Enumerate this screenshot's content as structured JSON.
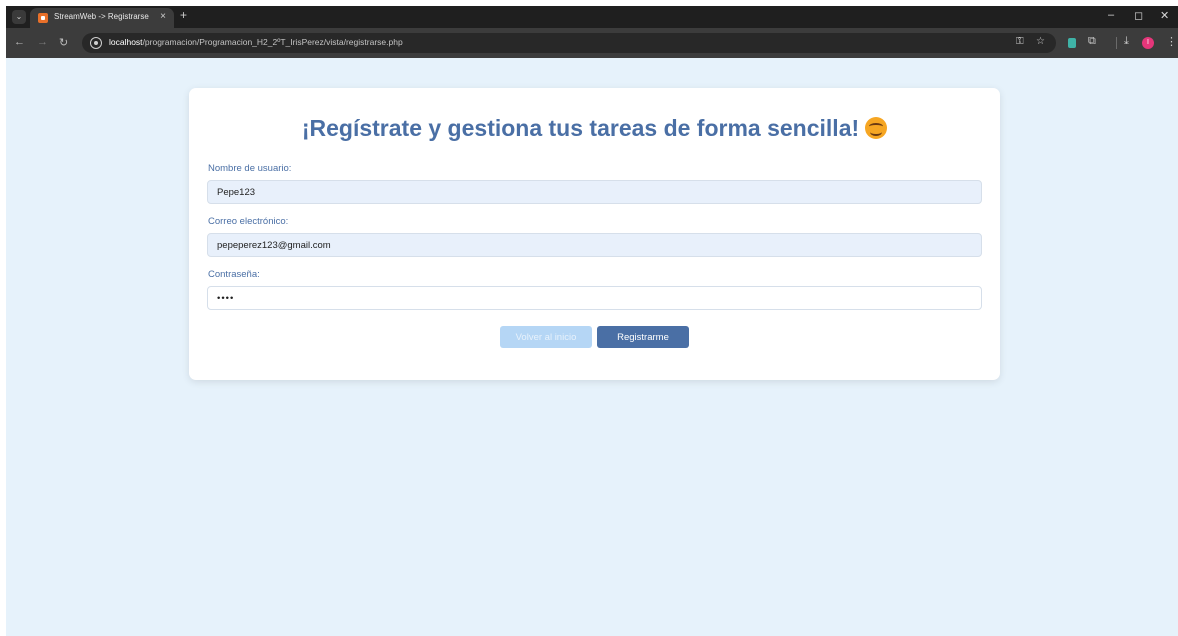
{
  "browser": {
    "tab_title": "StreamWeb -> Registrarse",
    "tab_close": "×",
    "new_tab": "+",
    "url_host": "localhost",
    "url_path": "/programacion/Programacion_H2_2ºT_IrisPerez/vista/registrarse.php",
    "profile_initial": "I",
    "icons": [
      "tab-menu-icon",
      "back-icon",
      "forward-icon",
      "reload-icon",
      "site-info-icon",
      "password-key-icon",
      "bookmark-star-icon",
      "extension-icon",
      "puzzle-icon",
      "download-icon",
      "profile-avatar",
      "more-menu-icon",
      "minimize-icon",
      "restore-icon",
      "close-window-icon"
    ]
  },
  "form": {
    "heading": "¡Regístrate y gestiona tus tareas de forma sencilla!",
    "username": {
      "label": "Nombre de usuario:",
      "value": "Pepe123"
    },
    "email": {
      "label": "Correo electrónico:",
      "value": "pepeperez123@gmail.com"
    },
    "password": {
      "label": "Contraseña:",
      "value": "••••"
    },
    "back_label": "Volver al inicio",
    "submit_label": "Registrarme"
  },
  "colors": {
    "accent": "#4a6fa5",
    "page_background": "#e6f2fb",
    "autofill_background": "#e8f0fb",
    "disabled_button": "#b5d6f5"
  }
}
